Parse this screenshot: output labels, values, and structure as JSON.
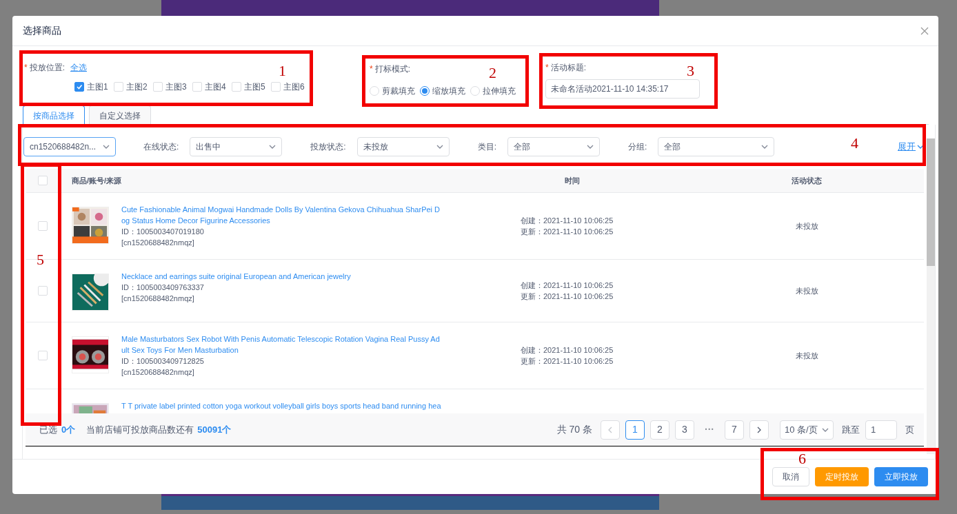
{
  "dialog": {
    "title": "选择商品"
  },
  "placement": {
    "required_mark": "*",
    "label": "投放位置:",
    "select_all": "全选",
    "options": [
      {
        "label": "主图1",
        "checked": true
      },
      {
        "label": "主图2",
        "checked": false
      },
      {
        "label": "主图3",
        "checked": false
      },
      {
        "label": "主图4",
        "checked": false
      },
      {
        "label": "主图5",
        "checked": false
      },
      {
        "label": "主图6",
        "checked": false
      }
    ]
  },
  "mark_mode": {
    "required_mark": "*",
    "label": "打标模式:",
    "options": [
      {
        "label": "剪裁填充",
        "selected": false
      },
      {
        "label": "缩放填充",
        "selected": true
      },
      {
        "label": "拉伸填充",
        "selected": false
      }
    ]
  },
  "activity_title": {
    "required_mark": "*",
    "label": "活动标题:",
    "value": "未命名活动2021-11-10 14:35:17"
  },
  "tabs": [
    {
      "label": "按商品选择",
      "selected": true
    },
    {
      "label": "自定义选择",
      "selected": false
    }
  ],
  "filters": {
    "account": "cn1520688482n...",
    "items": [
      {
        "label": "在线状态:",
        "value": "出售中"
      },
      {
        "label": "投放状态:",
        "value": "未投放"
      },
      {
        "label": "类目:",
        "value": "全部"
      },
      {
        "label": "分组:",
        "value": "全部"
      }
    ],
    "expand": "展开"
  },
  "table": {
    "select_all_checked": false,
    "columns": [
      "商品/账号/来源",
      "时间",
      "活动状态"
    ],
    "rows": [
      {
        "checked": false,
        "title": "Cute Fashionable Animal Mogwai Handmade Dolls By Valentina Gekova Chihuahua SharPei Dog Status Home Decor Figurine Accessories",
        "id": "ID：1005003407019180",
        "account": "[cn1520688482nmqz]",
        "created": "创建：2021-11-10 10:06:25",
        "updated": "更新：2021-11-10 10:06:25",
        "status": "未投放"
      },
      {
        "checked": false,
        "title": "Necklace and earrings suite original European and American jewelry",
        "id": "ID：1005003409763337",
        "account": "[cn1520688482nmqz]",
        "created": "创建：2021-11-10 10:06:25",
        "updated": "更新：2021-11-10 10:06:25",
        "status": "未投放"
      },
      {
        "checked": false,
        "title": "Male Masturbators Sex Robot With Penis Automatic Telescopic Rotation Vagina Real Pussy Adult Sex Toys For Men Masturbation",
        "id": "ID：1005003409712825",
        "account": "[cn1520688482nmqz]",
        "created": "创建：2021-11-10 10:06:25",
        "updated": "更新：2021-11-10 10:06:25",
        "status": "未投放"
      },
      {
        "title": "T T private label printed cotton yoga workout volleyball girls boys sports head band running hea"
      }
    ]
  },
  "summary": {
    "selected_label": "已选",
    "selected_count": "0个",
    "quota_label": "当前店铺可投放商品数还有",
    "quota_count": "50091个"
  },
  "pagination": {
    "total": "共 70 条",
    "pages": [
      {
        "label": "1",
        "kind": "page",
        "selected": true
      },
      {
        "label": "2",
        "kind": "page",
        "selected": false
      },
      {
        "label": "3",
        "kind": "page",
        "selected": false
      },
      {
        "label": "···",
        "kind": "ellipsis",
        "selected": false
      },
      {
        "label": "7",
        "kind": "page",
        "selected": false
      }
    ],
    "page_size": "10 条/页",
    "jump_label": "跳至",
    "jump_value": "1",
    "page_unit": "页"
  },
  "buttons": [
    {
      "label": "取消",
      "kind": "default"
    },
    {
      "label": "定时投放",
      "kind": "warning"
    },
    {
      "label": "立即投放",
      "kind": "primary"
    }
  ],
  "annotations": [
    {
      "label": "1"
    },
    {
      "label": "2"
    },
    {
      "label": "3"
    },
    {
      "label": "4"
    },
    {
      "label": "5"
    },
    {
      "label": "6"
    }
  ]
}
